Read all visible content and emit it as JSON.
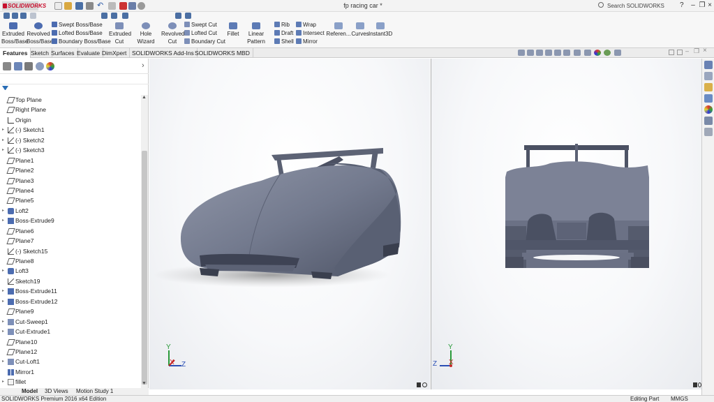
{
  "app": {
    "logo_text": "SOLIDWORKS",
    "document_title": "fp racing car *",
    "search_placeholder": "Search SOLIDWORKS Help",
    "help_label": "?"
  },
  "commands": {
    "extruded_boss": "Extruded Boss/Base",
    "revolved_boss": "Revolved Boss/Base",
    "swept_boss": "Swept Boss/Base",
    "lofted_boss": "Lofted Boss/Base",
    "boundary_boss": "Boundary Boss/Base",
    "extruded_cut": "Extruded Cut",
    "hole_wizard": "Hole Wizard",
    "revolved_cut": "Revolved Cut",
    "swept_cut": "Swept Cut",
    "lofted_cut": "Lofted Cut",
    "boundary_cut": "Boundary Cut",
    "fillet": "Fillet",
    "linear_pattern": "Linear Pattern",
    "rib": "Rib",
    "draft": "Draft",
    "shell": "Shell",
    "wrap": "Wrap",
    "intersect": "Intersect",
    "mirror": "Mirror",
    "reference": "Referen...",
    "curves": "Curves",
    "instant3d": "Instant3D"
  },
  "tabs": [
    {
      "label": "Features",
      "active": true
    },
    {
      "label": "Sketch"
    },
    {
      "label": "Surfaces"
    },
    {
      "label": "Evaluate"
    },
    {
      "label": "DimXpert"
    },
    {
      "label": "SOLIDWORKS Add-Ins"
    },
    {
      "label": "SOLIDWORKS MBD"
    }
  ],
  "tree": {
    "items": [
      {
        "label": "Top Plane",
        "icon": "plane-icon",
        "expandable": false
      },
      {
        "label": "Right Plane",
        "icon": "plane-icon",
        "expandable": false
      },
      {
        "label": "Origin",
        "icon": "origin-icon",
        "expandable": false
      },
      {
        "label": "(-) Sketch1",
        "icon": "sketch-icon",
        "expandable": true
      },
      {
        "label": "(-) Sketch2",
        "icon": "sketch-icon",
        "expandable": true
      },
      {
        "label": "(-) Sketch3",
        "icon": "sketch-icon",
        "expandable": true
      },
      {
        "label": "Plane1",
        "icon": "plane-icon",
        "expandable": false
      },
      {
        "label": "Plane2",
        "icon": "plane-icon",
        "expandable": false
      },
      {
        "label": "Plane3",
        "icon": "plane-icon",
        "expandable": false
      },
      {
        "label": "Plane4",
        "icon": "plane-icon",
        "expandable": false
      },
      {
        "label": "Plane5",
        "icon": "plane-icon",
        "expandable": false
      },
      {
        "label": "Loft2",
        "icon": "loft-icon",
        "expandable": true
      },
      {
        "label": "Boss-Extrude9",
        "icon": "extrude-icon",
        "expandable": true
      },
      {
        "label": "Plane6",
        "icon": "plane-icon",
        "expandable": false
      },
      {
        "label": "Plane7",
        "icon": "plane-icon",
        "expandable": false
      },
      {
        "label": "(-) Sketch15",
        "icon": "sketch-icon",
        "expandable": false
      },
      {
        "label": "Plane8",
        "icon": "plane-icon",
        "expandable": false
      },
      {
        "label": "Loft3",
        "icon": "loft-icon",
        "expandable": true
      },
      {
        "label": "Sketch19",
        "icon": "sketch-icon",
        "expandable": false
      },
      {
        "label": "Boss-Extrude11",
        "icon": "extrude-icon",
        "expandable": true
      },
      {
        "label": "Boss-Extrude12",
        "icon": "extrude-icon",
        "expandable": true
      },
      {
        "label": "Plane9",
        "icon": "plane-icon",
        "expandable": false
      },
      {
        "label": "Cut-Sweep1",
        "icon": "cut-icon",
        "expandable": true
      },
      {
        "label": "Cut-Extrude1",
        "icon": "cut-icon",
        "expandable": true
      },
      {
        "label": "Plane10",
        "icon": "plane-icon",
        "expandable": false
      },
      {
        "label": "Plane12",
        "icon": "plane-icon",
        "expandable": false
      },
      {
        "label": "Cut-Loft1",
        "icon": "cut-icon",
        "expandable": true
      },
      {
        "label": "Mirror1",
        "icon": "mirror-icon",
        "expandable": false
      },
      {
        "label": "fillet",
        "icon": "folder-icon",
        "expandable": true
      }
    ]
  },
  "bottom_tabs": [
    "Model",
    "3D Views",
    "Motion Study 1"
  ],
  "status": {
    "edition": "SOLIDWORKS Premium 2016 x64 Edition",
    "mode": "Editing Part",
    "units": "MMGS"
  },
  "triad": {
    "x": "X",
    "y": "Y",
    "z": "Z"
  },
  "colors": {
    "accent": "#c8102e",
    "model": "#70778a",
    "tab_active": "#ffffff"
  }
}
